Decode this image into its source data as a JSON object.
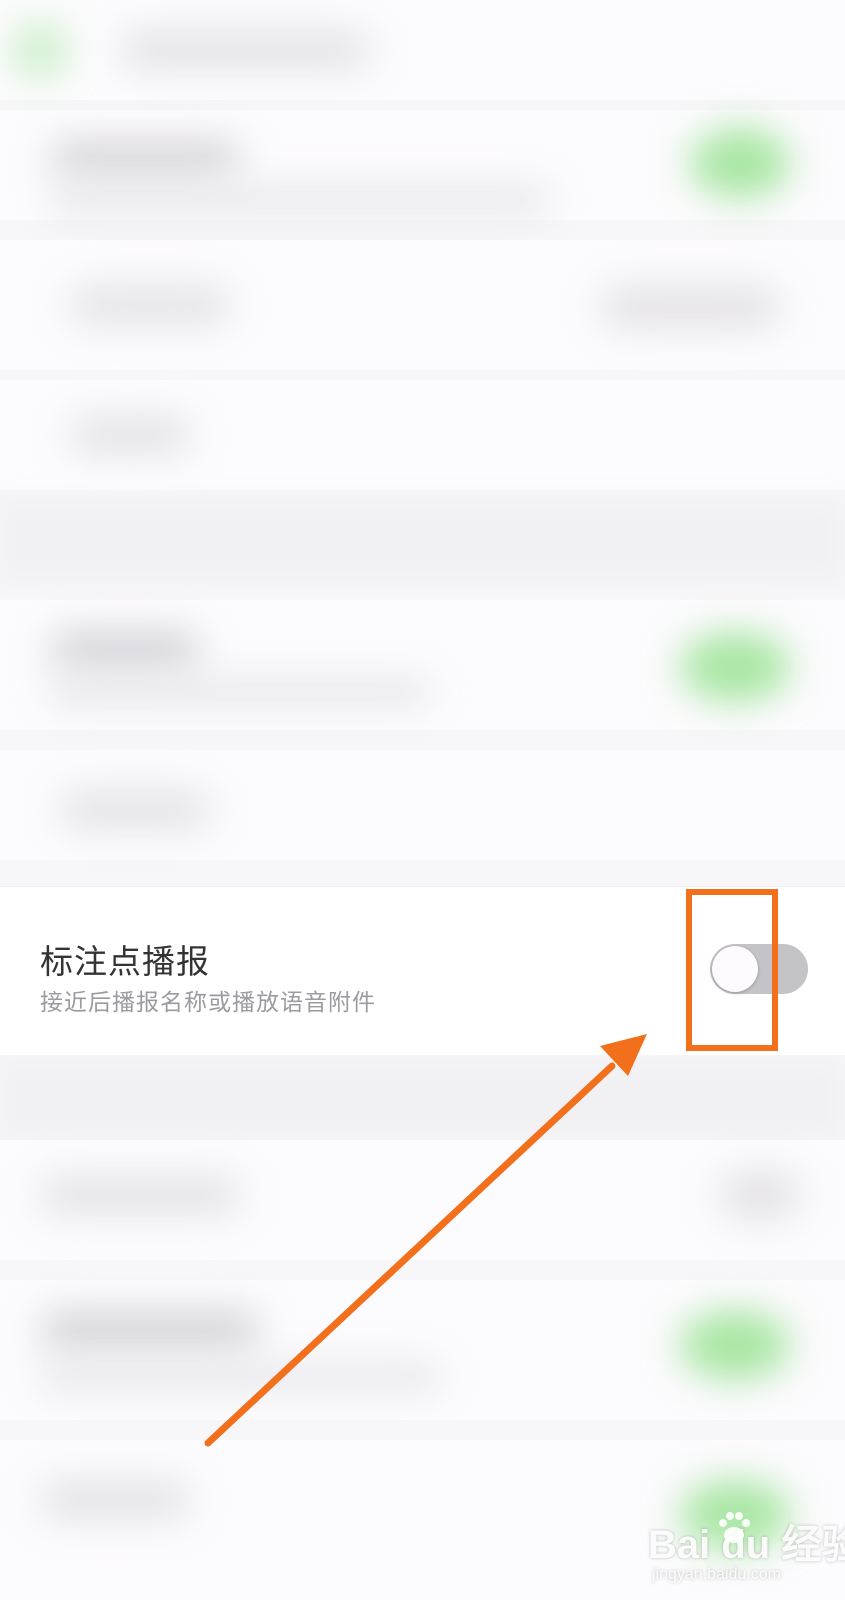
{
  "setting": {
    "title": "标注点播报",
    "description": "接近后播报名称或播放语音附件",
    "toggle_state": "off"
  },
  "watermark": {
    "brand_text": "Bai du 经验",
    "sub_text": "jingyan.baidu.com"
  },
  "annotation": {
    "highlight_color": "#f26f1c",
    "arrow_color": "#f26f1c"
  },
  "colors": {
    "toggle_off_track": "#c4c3c8",
    "blurred_toggle_on": "#a8e6a3"
  }
}
